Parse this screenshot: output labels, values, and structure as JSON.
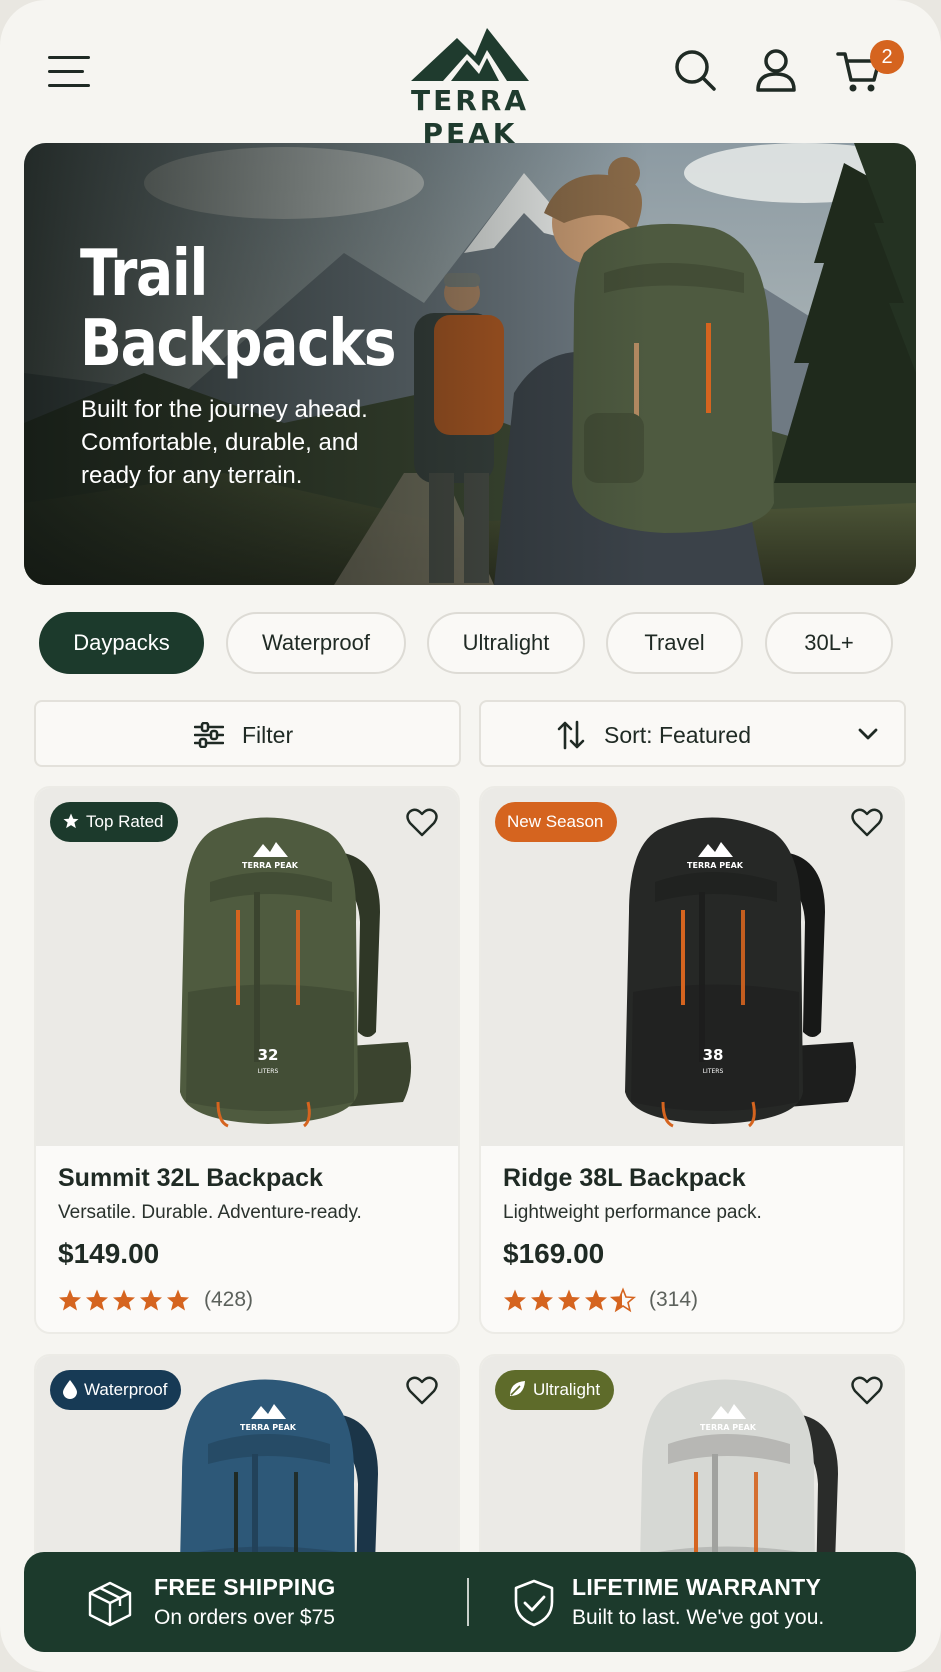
{
  "header": {
    "brand": "TERRA PEAK",
    "cart_count": "2",
    "icons": [
      "menu-icon",
      "search-icon",
      "user-icon",
      "cart-icon"
    ]
  },
  "hero": {
    "title_line1": "Trail",
    "title_line2": "Backpacks",
    "subtitle": "Built for the journey ahead. Comfortable, durable, and ready for any terrain."
  },
  "chips": [
    {
      "label": "Daypacks",
      "active": true
    },
    {
      "label": "Waterproof",
      "active": false
    },
    {
      "label": "Ultralight",
      "active": false
    },
    {
      "label": "Travel",
      "active": false
    },
    {
      "label": "30L+",
      "active": false
    }
  ],
  "controls": {
    "filter_label": "Filter",
    "sort_label": "Sort: Featured"
  },
  "products": [
    {
      "badge": "Top Rated",
      "badge_icon": "star-icon",
      "badge_color": "#1c3a2c",
      "pack_color": "#4f5b3f",
      "pack_label": "32",
      "name": "Summit 32L Backpack",
      "description": "Versatile. Durable. Adventure-ready.",
      "price": "$149.00",
      "rating": 5,
      "reviews": "(428)"
    },
    {
      "badge": "New Season",
      "badge_icon": "",
      "badge_color": "#d5641f",
      "pack_color": "#262826",
      "pack_label": "38",
      "name": "Ridge 38L Backpack",
      "description": "Lightweight performance pack.",
      "price": "$169.00",
      "rating": 4.5,
      "reviews": "(314)"
    },
    {
      "badge": "Waterproof",
      "badge_icon": "water-drop-icon",
      "badge_color": "#173a55",
      "pack_color": "#2d5878"
    },
    {
      "badge": "Ultralight",
      "badge_icon": "leaf-icon",
      "badge_color": "#5e6b2a",
      "pack_color": "#d6d8d4"
    }
  ],
  "pack_brand": "TERRA PEAK",
  "pack_liters_text": "LITERS",
  "banner": {
    "shipping_title": "FREE SHIPPING",
    "shipping_sub": "On orders over $75",
    "warranty_title": "LIFETIME WARRANTY",
    "warranty_sub": "Built to last. We've got you."
  },
  "colors": {
    "brand_green": "#1c3a2c",
    "accent_orange": "#d5641f",
    "star_orange": "#d5641f"
  }
}
